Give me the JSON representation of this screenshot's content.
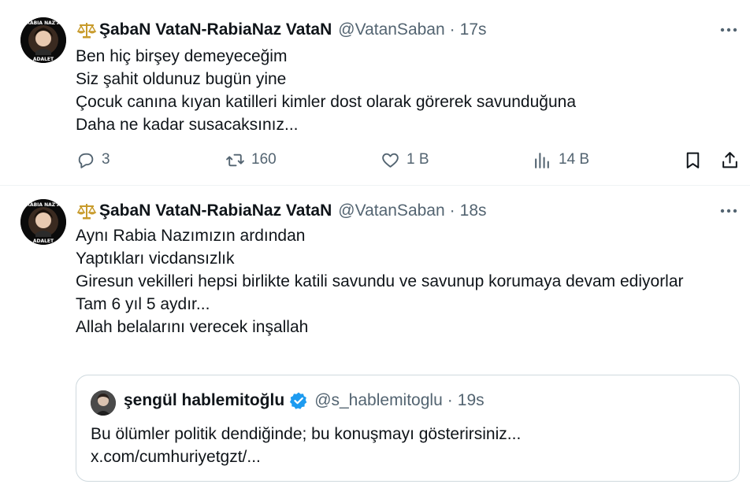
{
  "tweets": [
    {
      "display_name": "ŞabaN VataN-RabiaNaz VataN",
      "handle": "@VatanSaban",
      "separator": "·",
      "time": "17s",
      "lines": [
        "Ben hiç birşey demeyeceğim",
        "Siz şahit oldunuz bugün yine",
        "Çocuk canına kıyan katilleri kimler dost olarak görerek savunduğuna",
        "Daha ne kadar susacaksınız..."
      ],
      "actions": {
        "reply_count": "3",
        "retweet_count": "160",
        "like_count": "1 B",
        "view_count": "14 B"
      }
    },
    {
      "display_name": "ŞabaN VataN-RabiaNaz VataN",
      "handle": "@VatanSaban",
      "separator": "·",
      "time": "18s",
      "lines": [
        "Aynı Rabia Nazımızın ardından",
        "Yaptıkları vicdansızlık",
        "Giresun vekilleri hepsi birlikte katili savundu ve savunup korumaya devam ediyorlar",
        "Tam 6 yıl 5 aydır...",
        "Allah belalarını verecek inşallah"
      ],
      "quote": {
        "display_name": "şengül hablemitoğlu",
        "handle": "@s_hablemitoglu",
        "separator": "·",
        "time": "19s",
        "text": "Bu ölümler politik dendiğinde; bu konuşmayı gösterirsiniz...",
        "link": "x.com/cumhuriyetgzt/..."
      }
    }
  ],
  "icons": {
    "more": "more-horizontal-icon",
    "reply": "reply-bubble-icon",
    "retweet": "retweet-icon",
    "like": "heart-icon",
    "views": "views-bar-chart-icon",
    "bookmark": "bookmark-icon",
    "share": "share-upload-icon",
    "scales": "scales-of-justice-icon",
    "verified": "verified-badge-icon"
  },
  "colors": {
    "text_primary": "#0f1419",
    "text_secondary": "#536471",
    "border": "#cfd9de",
    "verified": "#1d9bf0",
    "divider": "#eff3f4"
  }
}
